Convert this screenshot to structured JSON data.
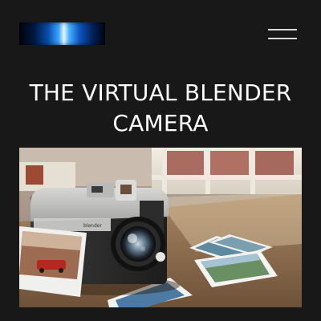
{
  "header": {
    "logo_icon": "brand-logo-gradient-icon",
    "menu_icon": "hamburger-menu-icon"
  },
  "hero": {
    "title": "THE VIRTUAL BLENDER CAMERA",
    "image_icon": "vintage-instant-camera-render",
    "camera_brand_text": "blender"
  },
  "colors": {
    "background": "#181818",
    "text": "#ffffff",
    "menu_lines": "#d8d8d8"
  }
}
